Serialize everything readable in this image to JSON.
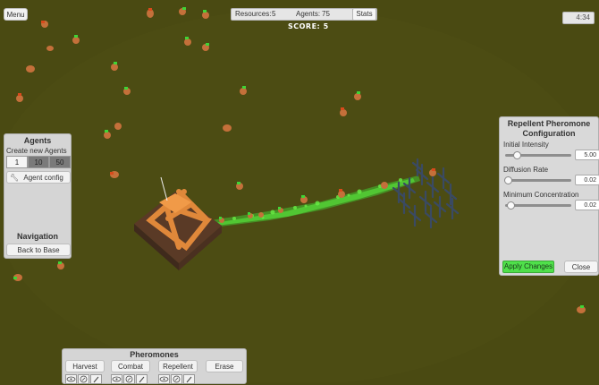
{
  "top": {
    "menu_label": "Menu",
    "stats_bar": {
      "resources_label": "Resources:",
      "resources_value": "5",
      "agents_label": "Agents:",
      "agents_value": "75",
      "stats_button": "Stats"
    },
    "score_label": "SCORE:",
    "score_value": "5",
    "clock": "4:34"
  },
  "agents_panel": {
    "title": "Agents",
    "create_label": "Create new Agents",
    "create_options": [
      "1",
      "10",
      "50"
    ],
    "selected_option": "10",
    "agent_config_label": "Agent config",
    "navigation_title": "Navigation",
    "back_label": "Back to Base"
  },
  "config_panel": {
    "title_line1": "Repellent Pheromone",
    "title_line2": "Configuration",
    "sliders": [
      {
        "label": "Initial Intensity",
        "value": "5.00",
        "fraction": 0.15
      },
      {
        "label": "Diffusion Rate",
        "value": "0.02",
        "fraction": 0.0
      },
      {
        "label": "Minimum Concentration",
        "value": "0.02",
        "fraction": 0.05
      }
    ],
    "apply_label": "Apply Changes",
    "close_label": "Close"
  },
  "pheromones_panel": {
    "title": "Pheromones",
    "buttons": [
      "Harvest",
      "Combat",
      "Repellent",
      "Erase"
    ]
  },
  "colors": {
    "ground": "#4a4a12",
    "trail": "#3fd436",
    "tower": "#e0883a",
    "agent_head": "#d94a1c",
    "agent_body": "#c4703a",
    "enemy": "#3a4a63",
    "apply_green": "#4fe04a"
  }
}
